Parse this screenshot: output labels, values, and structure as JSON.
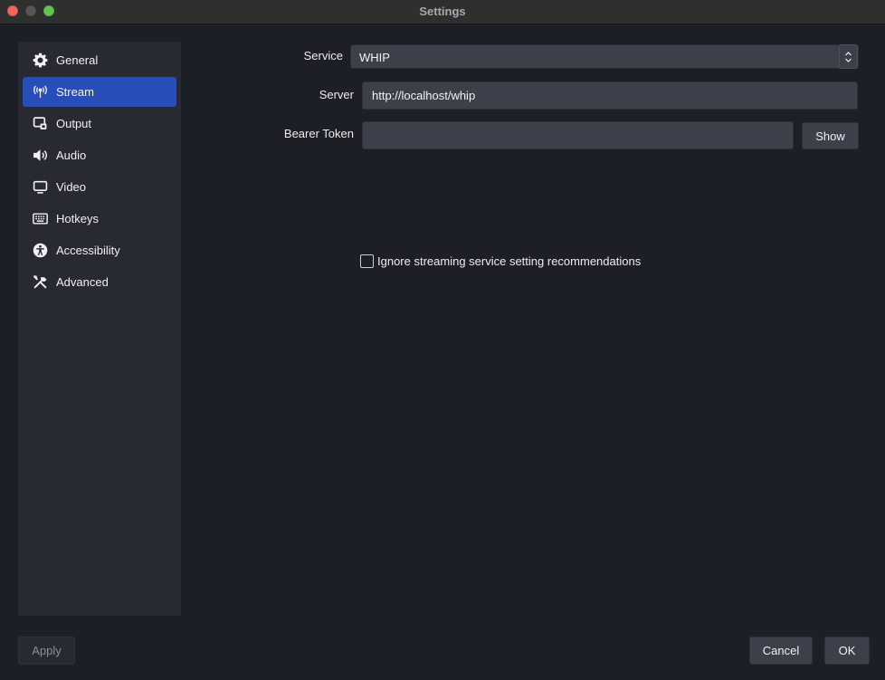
{
  "window": {
    "title": "Settings"
  },
  "sidebar": {
    "items": [
      {
        "label": "General",
        "icon": "gear-icon"
      },
      {
        "label": "Stream",
        "icon": "antenna-icon",
        "active": true
      },
      {
        "label": "Output",
        "icon": "output-icon"
      },
      {
        "label": "Audio",
        "icon": "speaker-icon"
      },
      {
        "label": "Video",
        "icon": "monitor-icon"
      },
      {
        "label": "Hotkeys",
        "icon": "keyboard-icon"
      },
      {
        "label": "Accessibility",
        "icon": "accessibility-icon"
      },
      {
        "label": "Advanced",
        "icon": "tools-icon"
      }
    ]
  },
  "stream": {
    "service_label": "Service",
    "service_value": "WHIP",
    "server_label": "Server",
    "server_value": "http://localhost/whip",
    "token_label": "Bearer Token",
    "token_value": "",
    "show_button": "Show",
    "ignore_label": "Ignore streaming service setting recommendations",
    "ignore_checked": false
  },
  "footer": {
    "apply": "Apply",
    "cancel": "Cancel",
    "ok": "OK"
  },
  "colors": {
    "background": "#1d1f26",
    "panel": "#272a33",
    "accent": "#284cb8",
    "input": "#3c404b"
  }
}
